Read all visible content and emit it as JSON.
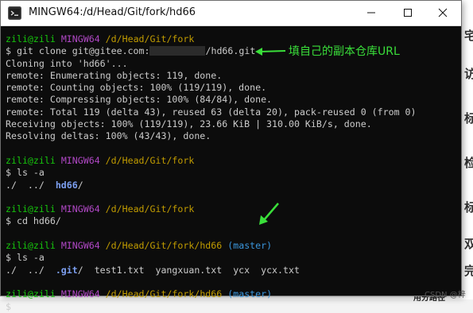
{
  "window": {
    "title": "MINGW64:/d/Head/Git/fork/hd66"
  },
  "annotation": {
    "text": "填自己的副本仓库URL"
  },
  "background": {
    "side_chars": [
      "宅",
      "访",
      "标",
      "检",
      "标",
      "双",
      "完"
    ],
    "bottom_text": "CSDN @梓",
    "bottom_left_text": "用分路径"
  },
  "terminal": {
    "prompt_user": "zili@zili",
    "prompt_host": "MINGW64",
    "lines": {
      "p1_path": "/d/Head/Git/fork",
      "cmd1_prefix": "$ git clone git@gitee.com:",
      "cmd1_suffix": "/hd66.git",
      "out1": "Cloning into 'hd66'...",
      "out2": "remote: Enumerating objects: 119, done.",
      "out3": "remote: Counting objects: 100% (119/119), done.",
      "out4": "remote: Compressing objects: 100% (84/84), done.",
      "out5": "remote: Total 119 (delta 43), reused 63 (delta 20), pack-reused 0 (from 0)",
      "out6": "Receiving objects: 100% (119/119), 23.66 KiB | 310.00 KiB/s, done.",
      "out7": "Resolving deltas: 100% (43/43), done.",
      "p2_path": "/d/Head/Git/fork",
      "cmd2": "$ ls -a",
      "ls1_dots": "./  ../  ",
      "ls1_dir": "hd66",
      "ls1_slash": "/",
      "p3_path": "/d/Head/Git/fork",
      "cmd3": "$ cd hd66/",
      "p4_path": "/d/Head/Git/fork/hd66",
      "p4_branch": "(master)",
      "cmd4": "$ ls -a",
      "ls2_dots": "./  ../  ",
      "ls2_git": ".git",
      "ls2_rest": "/  test1.txt  yangxuan.txt  ycx  ycx.txt",
      "p5_path": "/d/Head/Git/fork/hd66",
      "p5_branch": "(master)",
      "cmd5": "$"
    }
  },
  "colors": {
    "terminal_bg": "#0c0c0c",
    "prompt_user": "#16c60c",
    "prompt_host": "#b148c6",
    "prompt_path": "#c19c00",
    "branch": "#3a96dd",
    "directory": "#7c9ff0",
    "annotation": "#3adf3a"
  }
}
